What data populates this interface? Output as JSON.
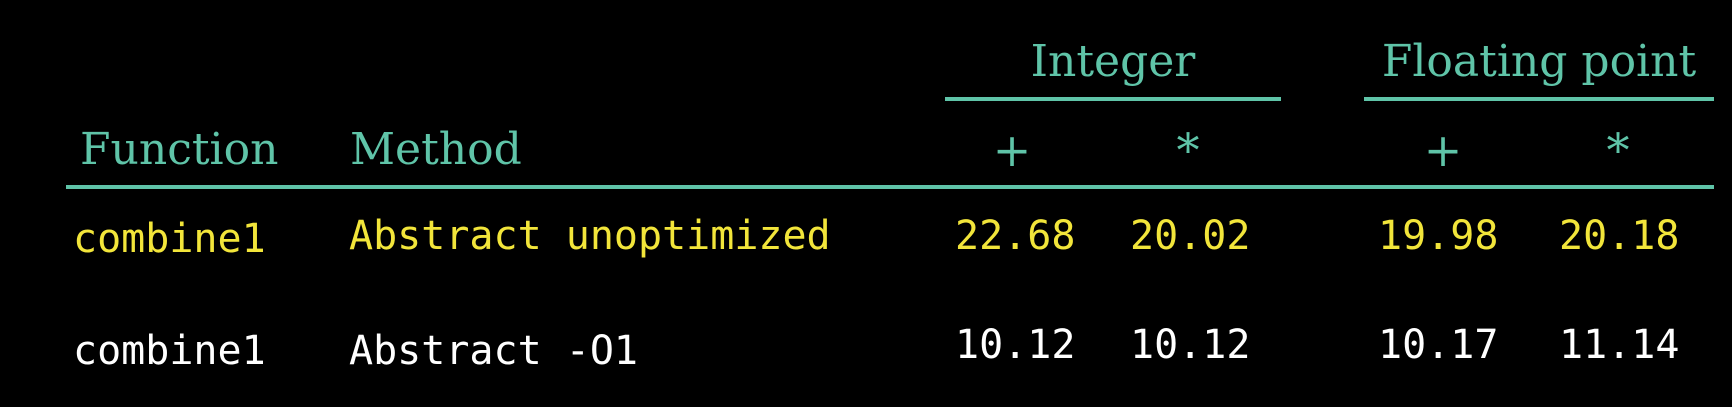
{
  "table": {
    "group_headers": {
      "integer": "Integer",
      "floating_point": "Floating point"
    },
    "column_headers": {
      "function": "Function",
      "method": "Method",
      "int_add": "+",
      "int_mul": "*",
      "fp_add": "+",
      "fp_mul": "*"
    },
    "rows": [
      {
        "function": "combine1",
        "method": "Abstract unoptimized",
        "int_add": "22.68",
        "int_mul": "20.02",
        "fp_add": "19.98",
        "fp_mul": "20.18",
        "color": "#f2e53a"
      },
      {
        "function": "combine1",
        "method": "Abstract -O1",
        "int_add": "10.12",
        "int_mul": "10.12",
        "fp_add": "10.17",
        "fp_mul": "11.14",
        "color": "#ffffff"
      }
    ]
  },
  "colors": {
    "header": "#5fc4a8",
    "highlight": "#f2e53a",
    "text": "#ffffff",
    "background": "#000000"
  }
}
